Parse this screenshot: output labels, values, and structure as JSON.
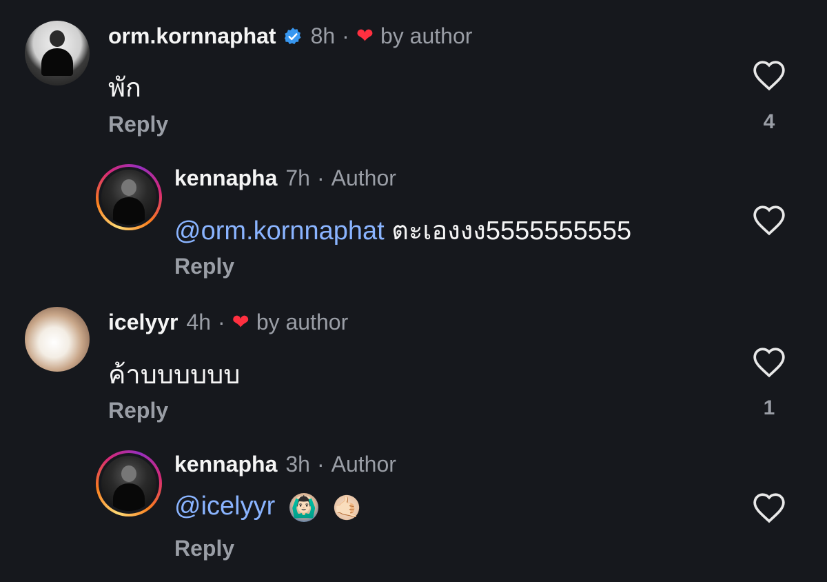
{
  "comments": [
    {
      "username": "orm.kornnaphat",
      "verified": true,
      "time": "8h",
      "liked_by_author": "by author",
      "text": "พัก",
      "reply_label": "Reply",
      "like_count": "4"
    },
    {
      "username": "kennapha",
      "time": "7h",
      "author_badge": "Author",
      "mention": "@orm.kornnaphat",
      "text": " ตะเองงง5555555555",
      "reply_label": "Reply"
    },
    {
      "username": "icelyyr",
      "time": "4h",
      "liked_by_author": "by author",
      "text": "ค้าบบบบบบ",
      "reply_label": "Reply",
      "like_count": "1"
    },
    {
      "username": "kennapha",
      "time": "3h",
      "author_badge": "Author",
      "mention": "@icelyyr",
      "emojis": [
        "🙆🏻‍♂️",
        "🤙🏻"
      ],
      "reply_label": "Reply"
    }
  ],
  "separator": "·",
  "icons": {
    "verified": "verified-badge-icon",
    "heart_filled": "heart-filled-icon",
    "heart_outline": "heart-outline-icon"
  },
  "colors": {
    "background": "#16181d",
    "mention": "#8ab4ff",
    "heart": "#ff3040",
    "verified": "#3897f0",
    "muted": "#9a9ea6"
  }
}
